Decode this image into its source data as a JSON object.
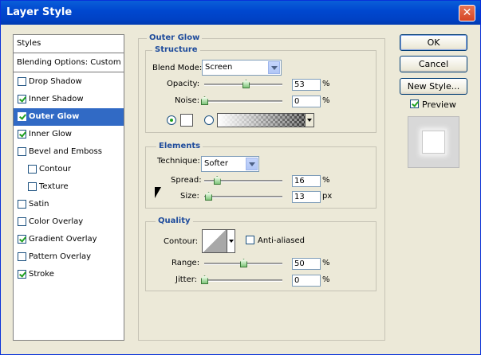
{
  "window": {
    "title": "Layer Style"
  },
  "styles": {
    "header": "Styles",
    "blending": "Blending Options: Custom",
    "items": [
      {
        "label": "Drop Shadow",
        "checked": false
      },
      {
        "label": "Inner Shadow",
        "checked": true
      },
      {
        "label": "Outer Glow",
        "checked": true,
        "selected": true
      },
      {
        "label": "Inner Glow",
        "checked": true
      },
      {
        "label": "Bevel and Emboss",
        "checked": false
      },
      {
        "label": "Contour",
        "checked": false
      },
      {
        "label": "Texture",
        "checked": false
      },
      {
        "label": "Satin",
        "checked": false
      },
      {
        "label": "Color Overlay",
        "checked": false
      },
      {
        "label": "Gradient Overlay",
        "checked": true
      },
      {
        "label": "Pattern Overlay",
        "checked": false
      },
      {
        "label": "Stroke",
        "checked": true
      }
    ]
  },
  "outer_glow": {
    "title": "Outer Glow",
    "structure": {
      "title": "Structure",
      "blend_mode_label": "Blend Mode:",
      "blend_mode": "Screen",
      "opacity_label": "Opacity:",
      "opacity": "53",
      "opacity_fraction": 0.53,
      "noise_label": "Noise:",
      "noise": "0",
      "noise_fraction": 0.0,
      "unit_percent": "%"
    },
    "elements": {
      "title": "Elements",
      "technique_label": "Technique:",
      "technique": "Softer",
      "spread_label": "Spread:",
      "spread": "16",
      "spread_fraction": 0.16,
      "size_label": "Size:",
      "size": "13",
      "size_fraction": 0.052,
      "unit_percent": "%",
      "unit_px": "px"
    },
    "quality": {
      "title": "Quality",
      "contour_label": "Contour:",
      "anti_aliased_label": "Anti-aliased",
      "anti_aliased": false,
      "range_label": "Range:",
      "range": "50",
      "range_fraction": 0.5,
      "jitter_label": "Jitter:",
      "jitter": "0",
      "jitter_fraction": 0.0,
      "unit_percent": "%"
    }
  },
  "buttons": {
    "ok": "OK",
    "cancel": "Cancel",
    "new_style": "New Style...",
    "preview_label": "Preview",
    "preview_checked": true
  },
  "colors": {
    "accent": "#316ac5",
    "legend": "#1f4c9c",
    "check": "#21a121"
  }
}
